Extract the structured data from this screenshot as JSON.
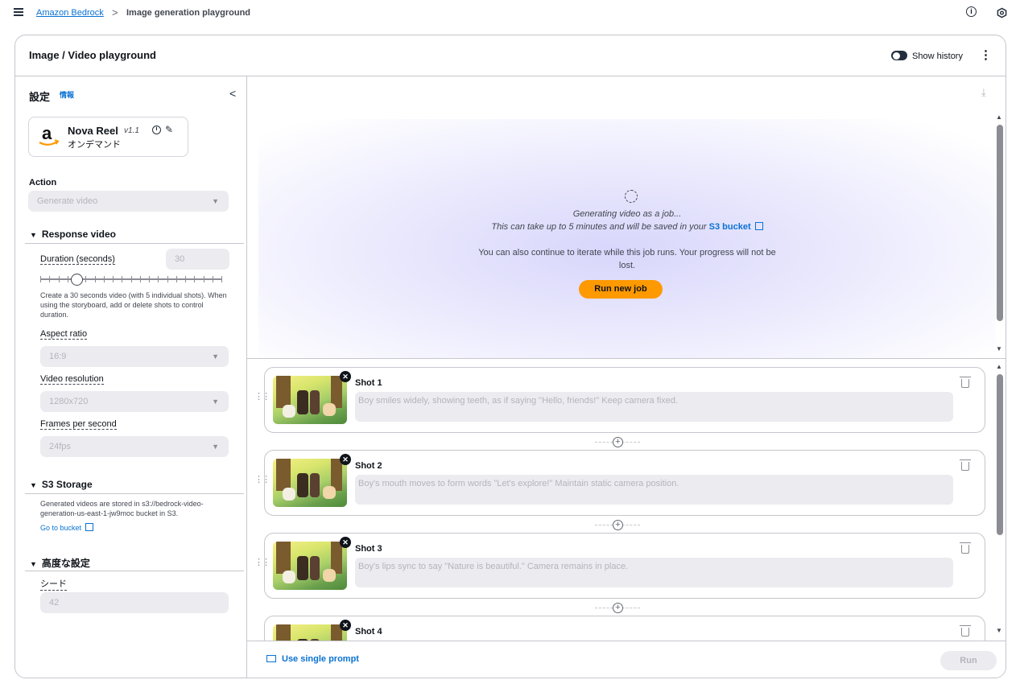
{
  "breadcrumb": {
    "root": "Amazon Bedrock",
    "separator": ">",
    "current": "Image generation playground"
  },
  "panel": {
    "title": "Image / Video playground",
    "show_history_label": "Show history",
    "more_icon": "⋮"
  },
  "settings": {
    "title": "設定",
    "info_label": "情報",
    "collapse_icon": "<",
    "model": {
      "name": "Nova Reel",
      "version": "v1.1",
      "mode": "オンデマンド",
      "info_icon": "i",
      "edit_icon": "✎"
    },
    "action": {
      "label": "Action",
      "value": "Generate video"
    },
    "response_video": {
      "title": "Response video",
      "duration_label": "Duration (seconds)",
      "duration_value": "30",
      "slider_fraction": 0.2,
      "help": "Create a 30 seconds video (with 5 individual shots). When using the storyboard, add or delete shots to control duration.",
      "aspect_label": "Aspect ratio",
      "aspect_value": "16:9",
      "resolution_label": "Video resolution",
      "resolution_value": "1280x720",
      "fps_label": "Frames per second",
      "fps_value": "24fps"
    },
    "s3": {
      "title": "S3 Storage",
      "help": "Generated videos are stored in s3://bedrock-video-generation-us-east-1-jw9moc bucket in S3.",
      "link": "Go to bucket"
    },
    "advanced": {
      "title": "高度な設定",
      "seed_label": "シード",
      "seed_value": "42"
    }
  },
  "generation": {
    "line1": "Generating video as a job...",
    "line2": "This can take up to 5 minutes and will be saved in your",
    "bucket_link": "S3 bucket",
    "line3": "You can also continue to iterate while this job runs. Your progress will not be lost.",
    "run_new_job": "Run new job"
  },
  "shots": [
    {
      "title": "Shot 1",
      "prompt": "Boy smiles widely, showing teeth, as if saying \"Hello, friends!\" Keep camera fixed."
    },
    {
      "title": "Shot 2",
      "prompt": "Boy's mouth moves to form words \"Let's explore!\" Maintain static camera position."
    },
    {
      "title": "Shot 3",
      "prompt": "Boy's lips sync to say \"Nature is beautiful.\" Camera remains in place."
    },
    {
      "title": "Shot 4",
      "prompt": ""
    }
  ],
  "footer": {
    "single_prompt": "Use single prompt",
    "run": "Run"
  },
  "colors": {
    "accent": "#0972d3",
    "primary_button": "#ff9900",
    "disabled_bg": "#ebebf0",
    "disabled_text": "#b4b4bb"
  }
}
